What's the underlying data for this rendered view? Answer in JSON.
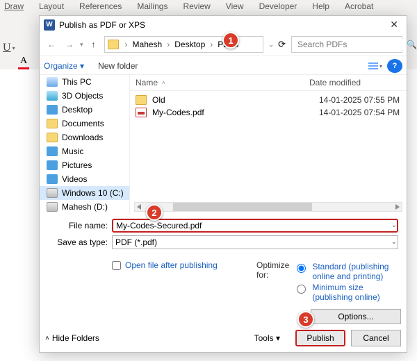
{
  "ribbon": {
    "tabs": [
      "Draw",
      "Layout",
      "References",
      "Mailings",
      "Review",
      "View",
      "Developer",
      "Help",
      "Acrobat"
    ]
  },
  "dialog": {
    "title": "Publish as PDF or XPS",
    "breadcrumb": [
      "Mahesh",
      "Desktop",
      "PDFs"
    ],
    "search_placeholder": "Search PDFs",
    "organize": "Organize",
    "new_folder": "New folder"
  },
  "tree": {
    "items": [
      {
        "label": "This PC",
        "icon": "pc"
      },
      {
        "label": "3D Objects",
        "icon": "3d"
      },
      {
        "label": "Desktop",
        "icon": "desk"
      },
      {
        "label": "Documents",
        "icon": "doc"
      },
      {
        "label": "Downloads",
        "icon": "dl"
      },
      {
        "label": "Music",
        "icon": "music"
      },
      {
        "label": "Pictures",
        "icon": "pic"
      },
      {
        "label": "Videos",
        "icon": "vid"
      },
      {
        "label": "Windows 10 (C:)",
        "icon": "drive",
        "selected": true
      },
      {
        "label": "Mahesh (D:)",
        "icon": "drive"
      }
    ]
  },
  "columns": {
    "name": "Name",
    "date": "Date modified"
  },
  "rows": [
    {
      "name": "Old",
      "date": "14-01-2025 07:55 PM",
      "type": "folder"
    },
    {
      "name": "My-Codes.pdf",
      "date": "14-01-2025 07:54 PM",
      "type": "pdf"
    }
  ],
  "form": {
    "filename_label": "File name:",
    "filename_value": "My-Codes-Secured.pdf",
    "saveas_label": "Save as type:",
    "saveas_value": "PDF (*.pdf)",
    "open_after": "Open file after publishing",
    "optimize_label": "Optimize for:",
    "opt_standard": "Standard (publishing online and printing)",
    "opt_minimum": "Minimum size (publishing online)",
    "options_btn": "Options..."
  },
  "footer": {
    "hide_folders": "Hide Folders",
    "tools": "Tools",
    "publish": "Publish",
    "cancel": "Cancel"
  },
  "callouts": {
    "c1": "1",
    "c2": "2",
    "c3": "3"
  }
}
